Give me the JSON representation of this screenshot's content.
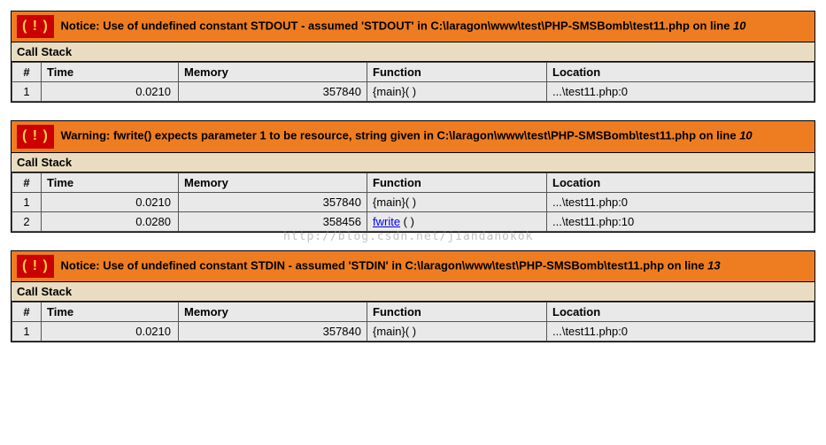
{
  "watermark": "http://blog.csdn.net/jiandanokok",
  "errors": [
    {
      "type": "Notice",
      "message": "Use of undefined constant STDOUT - assumed 'STDOUT' in C:\\laragon\\www\\test\\PHP-SMSBomb\\test11.php on line ",
      "line": "10",
      "callstack_label": "Call Stack",
      "headers": {
        "num": "#",
        "time": "Time",
        "memory": "Memory",
        "function": "Function",
        "location": "Location"
      },
      "rows": [
        {
          "num": "1",
          "time": "0.0210",
          "memory": "357840",
          "function": "{main}( )",
          "is_link": false,
          "location": "...\\test11.php:0"
        }
      ]
    },
    {
      "type": "Warning",
      "message": "fwrite() expects parameter 1 to be resource, string given in C:\\laragon\\www\\test\\PHP-SMSBomb\\test11.php on line ",
      "line": "10",
      "callstack_label": "Call Stack",
      "headers": {
        "num": "#",
        "time": "Time",
        "memory": "Memory",
        "function": "Function",
        "location": "Location"
      },
      "rows": [
        {
          "num": "1",
          "time": "0.0210",
          "memory": "357840",
          "function": "{main}( )",
          "is_link": false,
          "location": "...\\test11.php:0"
        },
        {
          "num": "2",
          "time": "0.0280",
          "memory": "358456",
          "function": "fwrite ( )",
          "function_name": "fwrite",
          "is_link": true,
          "location": "...\\test11.php:10"
        }
      ]
    },
    {
      "type": "Notice",
      "message": "Use of undefined constant STDIN - assumed 'STDIN' in C:\\laragon\\www\\test\\PHP-SMSBomb\\test11.php on line ",
      "line": "13",
      "callstack_label": "Call Stack",
      "headers": {
        "num": "#",
        "time": "Time",
        "memory": "Memory",
        "function": "Function",
        "location": "Location"
      },
      "rows": [
        {
          "num": "1",
          "time": "0.0210",
          "memory": "357840",
          "function": "{main}( )",
          "is_link": false,
          "location": "...\\test11.php:0"
        }
      ]
    }
  ]
}
